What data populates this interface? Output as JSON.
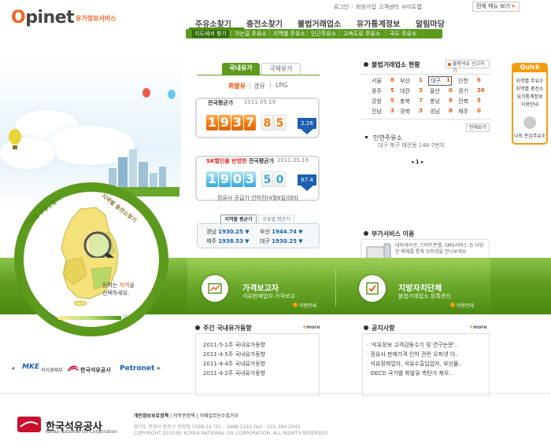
{
  "header": {
    "logo_rest": "pinet",
    "logo_o": "O",
    "logo_sub": "유가정보서비스",
    "utility": [
      "로그인",
      "회원가입",
      "고객센터",
      "사이트맵"
    ],
    "menu_all": "전체 메뉴 보기",
    "gnb": [
      "주유소찾기",
      "충전소찾기",
      "불법거래업소",
      "유가통계정보",
      "알림마당"
    ],
    "subnav": [
      "지도에서 찾기",
      "가는길 주유소",
      "지역별 주유소",
      "인근주유소",
      "고속도로 주유소",
      "국도 주유소"
    ]
  },
  "map": {
    "ring_label_left": "지역별 주유소찾기",
    "ring_label_right": "지역별 충전소찾기",
    "hint_pre": "원하는 ",
    "hint_hl": "지역",
    "hint_post": "을",
    "hint_line2": "선택하세요.",
    "legend_low": "저",
    "legend_high": "고"
  },
  "prices": {
    "tabs": [
      "국내유가",
      "국제유가"
    ],
    "fuels": [
      "휘발유",
      "경유",
      "LPG"
    ],
    "national": {
      "title": "전국평균가",
      "date": "2011.05.19",
      "int_digits": [
        "1",
        "9",
        "3",
        "7"
      ],
      "dec_digits": [
        "8",
        "5"
      ],
      "change": "2.26"
    },
    "discount": {
      "title_red": "SK할인을 반영한",
      "title_rest": " 전국평균가",
      "date": "2011.05.19",
      "int_digits": [
        "1",
        "9",
        "0",
        "3"
      ],
      "dec_digits": [
        "5",
        "0"
      ],
      "change": "67.4",
      "note": "정유사 공급가 인하전(4월6일)대비"
    },
    "region_tabs": [
      "지역별 평균가",
      "상표별 평균가"
    ],
    "regions": [
      {
        "name": "경남",
        "value": "1930.25"
      },
      {
        "name": "부산",
        "value": "1944.74"
      },
      {
        "name": "제주",
        "value": "1938.53"
      },
      {
        "name": "대구",
        "value": "1930.25"
      }
    ]
  },
  "illegal": {
    "title": "불법거래업소 현황",
    "report_btn": "불량석유 신고하기",
    "cells": [
      {
        "name": "서울",
        "n": "8"
      },
      {
        "name": "부산",
        "n": "1"
      },
      {
        "name": "대구",
        "n": "1"
      },
      {
        "name": "인천",
        "n": "6"
      },
      {
        "name": "광주",
        "n": "5"
      },
      {
        "name": "대전",
        "n": "3"
      },
      {
        "name": "울산",
        "n": "0"
      },
      {
        "name": "경기",
        "n": "36"
      },
      {
        "name": "강원",
        "n": "5"
      },
      {
        "name": "충북",
        "n": "7"
      },
      {
        "name": "충남",
        "n": "8"
      },
      {
        "name": "전북",
        "n": "5"
      },
      {
        "name": "전남",
        "n": "3"
      },
      {
        "name": "경북",
        "n": "3"
      },
      {
        "name": "경남",
        "n": "8"
      },
      {
        "name": "제주",
        "n": "0"
      }
    ],
    "more_btn": "전체보기",
    "station_name": "인연주유소",
    "station_addr": "대구 북구 태전동 148-7번지",
    "pager": "1"
  },
  "quick": {
    "head": "Quick",
    "items": [
      "지역별 주유소",
      "지역별 충전소",
      "유가통계정보",
      "이용안내"
    ],
    "fav": "나의 관심주유소"
  },
  "service": {
    "title": "부가서비스 이용",
    "text": "네비게이션, 스마트폰웹, SMS서비스 등 다양한 매체를 통해 오피넷을 만나보세요.",
    "go": "GO"
  },
  "band": {
    "items": [
      {
        "title": "가격보고자",
        "sub": "석유판매업자 가격보고",
        "link": "이용안내"
      },
      {
        "title": "지방자치단체",
        "sub": "불법거래업소 등록관리",
        "link": "이용안내"
      }
    ]
  },
  "news": {
    "title": "주간 국내유가동향",
    "more": "more",
    "items": [
      "2011-5-1주 국내유가동향",
      "2011-4-5주 국내유가동향",
      "2011-4-4주 국내유가동향",
      "2011-4-2주 국내유가동향"
    ]
  },
  "notice": {
    "title": "공지사항",
    "more": "more",
    "items": [
      "'석유정보 고객감동수기 및 연구논문'..",
      "정유사 판매가격 인하 관련 오피넷 이..",
      "석유정제업자, 석유수출입업자, 부산물..",
      "OECD 국가별 휘발유 측탄가 제우.."
    ]
  },
  "partners": {
    "mke": "MKE",
    "mke_name": "지식경제부",
    "knoc_name": "한국석유공사",
    "petronet": "Petronet"
  },
  "footer": {
    "logo_name": "한국석유공사",
    "logo_en": "Korea National Oil Corporation",
    "link_privacy": "개인정보보호정책",
    "link_copyright": "저작권정책",
    "link_email": "이메일무단수집거부",
    "address": "경기도 안양시 동안구 관양동 1588-14   TEL : 1688-5142   FAX : 031-380-2045",
    "copyright": "COPYRIGHT 2010 BY KOREA NATIONAL OIL CORPORATION. ALL RIGHTS RESERVED"
  },
  "colors": {
    "brand_orange": "#f26522",
    "brand_green": "#5c9a1d",
    "accent_blue": "#1d5fb0"
  }
}
